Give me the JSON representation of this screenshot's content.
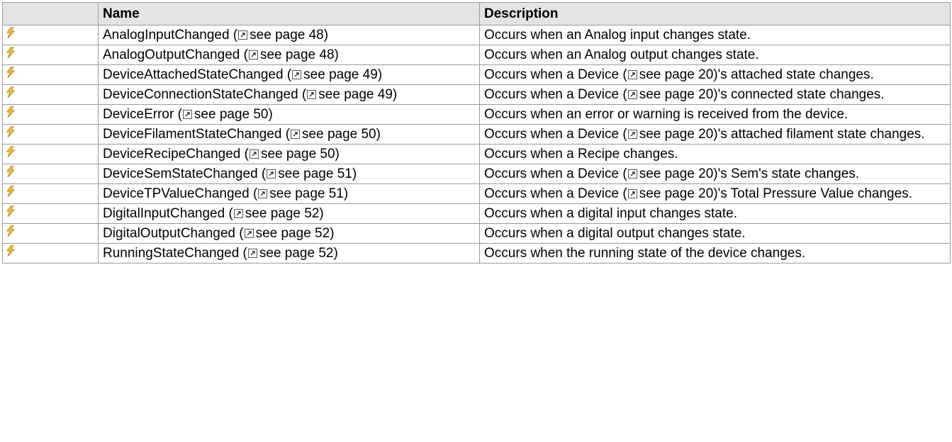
{
  "table": {
    "headers": {
      "icon": "",
      "name": "Name",
      "description": "Description"
    },
    "icon_name": "event-lightning-icon",
    "link_icon_name": "external-link-icon",
    "rows": [
      {
        "name": "AnalogInputChanged",
        "see": "see page 48",
        "desc": [
          {
            "t": "Occurs when an Analog input changes state."
          }
        ]
      },
      {
        "name": "AnalogOutputChanged",
        "see": "see page 48",
        "desc": [
          {
            "t": "Occurs when an Analog output changes state."
          }
        ]
      },
      {
        "name": "DeviceAttachedStateChanged",
        "see": "see page 49",
        "desc": [
          {
            "t": "Occurs when a Device ("
          },
          {
            "link": "see page 20"
          },
          {
            "t": ")'s attached state changes."
          }
        ]
      },
      {
        "name": "DeviceConnectionStateChanged",
        "see": "see page 49",
        "desc": [
          {
            "t": "Occurs when a Device ("
          },
          {
            "link": "see page 20"
          },
          {
            "t": ")'s connected state changes."
          }
        ]
      },
      {
        "name": "DeviceError",
        "see": "see page 50",
        "desc": [
          {
            "t": "Occurs when an error or warning is received from the device."
          }
        ]
      },
      {
        "name": "DeviceFilamentStateChanged",
        "see": "see page 50",
        "desc": [
          {
            "t": "Occurs when a Device ("
          },
          {
            "link": "see page 20"
          },
          {
            "t": ")'s attached filament state changes."
          }
        ]
      },
      {
        "name": "DeviceRecipeChanged",
        "see": "see page 50",
        "desc": [
          {
            "t": "Occurs when a Recipe changes."
          }
        ]
      },
      {
        "name": "DeviceSemStateChanged",
        "see": "see page 51",
        "desc": [
          {
            "t": "Occurs when a Device ("
          },
          {
            "link": "see page 20"
          },
          {
            "t": ")'s Sem's state changes."
          }
        ]
      },
      {
        "name": "DeviceTPValueChanged",
        "see": "see page 51",
        "desc": [
          {
            "t": "Occurs when a Device ("
          },
          {
            "link": "see page 20"
          },
          {
            "t": ")'s Total Pressure Value changes."
          }
        ]
      },
      {
        "name": "DigitalInputChanged",
        "see": "see page 52",
        "desc": [
          {
            "t": "Occurs when a digital input changes state."
          }
        ]
      },
      {
        "name": "DigitalOutputChanged",
        "see": "see page 52",
        "desc": [
          {
            "t": "Occurs when a digital output changes state."
          }
        ]
      },
      {
        "name": "RunningStateChanged",
        "see": "see page 52",
        "desc": [
          {
            "t": "Occurs when the running state of the device changes."
          }
        ]
      }
    ]
  }
}
